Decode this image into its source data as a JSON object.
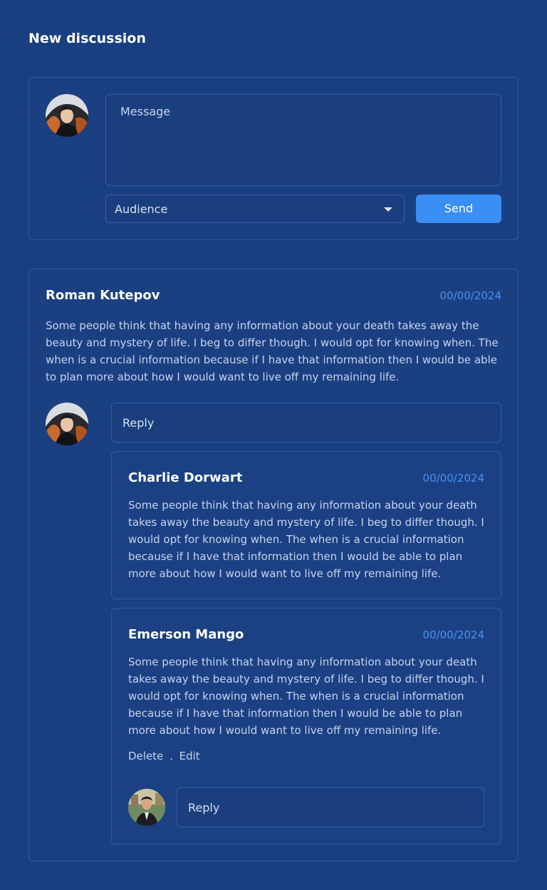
{
  "page": {
    "title": "New discussion"
  },
  "composer": {
    "message_placeholder": "Message",
    "audience_label": "Audience",
    "send_label": "Send"
  },
  "thread": {
    "author": "Roman Kutepov",
    "date": "00/00/2024",
    "text": "Some people think that having any information about your death takes away the beauty and mystery of life. I beg to differ though. I would opt for knowing when. The when is a crucial information because if I have that information then I would be able to plan more about how I would want to live off my remaining life.",
    "reply_placeholder": "Reply",
    "replies": [
      {
        "author": "Charlie Dorwart",
        "date": "00/00/2024",
        "text": "Some people think that having any information about your death takes away the beauty and mystery of life. I beg to differ though. I would opt for knowing when. The when is a crucial information because if I have that information then I would be able to plan more about how I would want to live off my remaining life."
      },
      {
        "author": "Emerson Mango",
        "date": "00/00/2024",
        "text": "Some people think that having any information about your death takes away the beauty and mystery of life. I beg to differ though. I would opt for knowing when. The when is a crucial information because if I have that information then I would be able to plan more about how I would want to live off my remaining life.",
        "delete_label": "Delete",
        "separator": ".",
        "edit_label": "Edit",
        "reply_placeholder": "Reply"
      }
    ]
  },
  "colors": {
    "background": "#1a3f80",
    "accent": "#3b8ef3",
    "date": "#4a92f0"
  }
}
